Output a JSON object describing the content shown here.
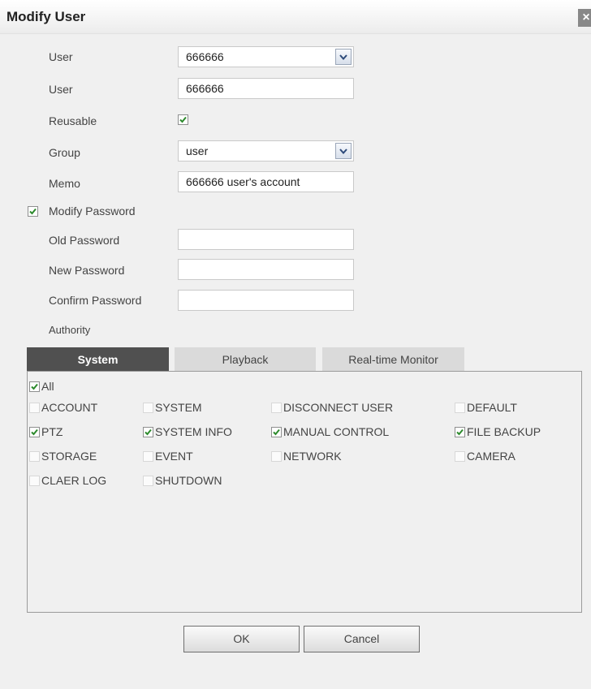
{
  "dialog": {
    "title": "Modify User",
    "close_glyph": "×"
  },
  "form": {
    "user_select_label": "User",
    "user_select_value": "666666",
    "user_name_label": "User",
    "user_name_value": "666666",
    "reusable_label": "Reusable",
    "reusable_checked": true,
    "group_label": "Group",
    "group_value": "user",
    "memo_label": "Memo",
    "memo_value": "666666 user's account",
    "modify_password_label": "Modify Password",
    "modify_password_checked": true,
    "old_password_label": "Old Password",
    "old_password_value": "",
    "new_password_label": "New Password",
    "new_password_value": "",
    "confirm_password_label": "Confirm Password",
    "confirm_password_value": "",
    "authority_label": "Authority"
  },
  "tabs": [
    {
      "label": "System",
      "active": true
    },
    {
      "label": "Playback",
      "active": false
    },
    {
      "label": "Real-time Monitor",
      "active": false
    }
  ],
  "permissions": {
    "all": {
      "label": "All",
      "checked": true
    },
    "items": [
      {
        "label": "ACCOUNT",
        "checked": false
      },
      {
        "label": "SYSTEM",
        "checked": false
      },
      {
        "label": "DISCONNECT USER",
        "checked": false
      },
      {
        "label": "DEFAULT",
        "checked": false
      },
      {
        "label": "PTZ",
        "checked": true
      },
      {
        "label": "SYSTEM INFO",
        "checked": true
      },
      {
        "label": "MANUAL CONTROL",
        "checked": true
      },
      {
        "label": "FILE BACKUP",
        "checked": true
      },
      {
        "label": "STORAGE",
        "checked": false
      },
      {
        "label": "EVENT",
        "checked": false
      },
      {
        "label": "NETWORK",
        "checked": false
      },
      {
        "label": "CAMERA",
        "checked": false
      },
      {
        "label": "CLAER LOG",
        "checked": false
      },
      {
        "label": "SHUTDOWN",
        "checked": false
      }
    ]
  },
  "buttons": {
    "ok_label": "OK",
    "cancel_label": "Cancel"
  },
  "colors": {
    "check_mark": "#2c8a2c",
    "active_tab": "#505050"
  }
}
